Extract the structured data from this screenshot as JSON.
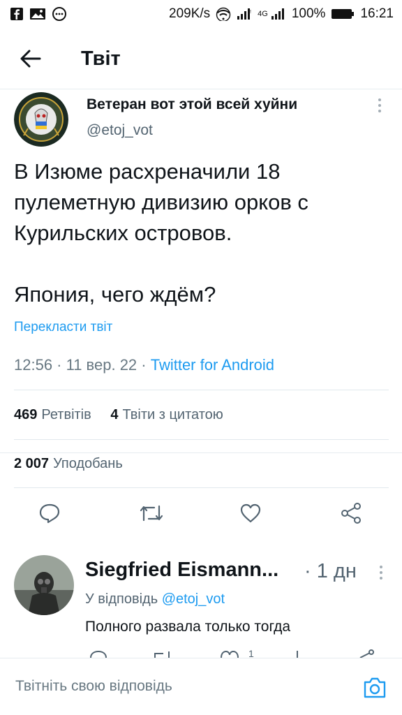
{
  "status_bar": {
    "network_speed": "209K/s",
    "signal_small": "4G",
    "battery": "100%",
    "time": "16:21",
    "left_icons": [
      "facebook-icon",
      "image-icon",
      "message-icon"
    ],
    "right_icons": [
      "wifi-icon",
      "signal-icon",
      "signal-4g-icon",
      "battery-icon"
    ]
  },
  "header": {
    "title": "Твіт",
    "back_icon": "arrow-left-icon"
  },
  "tweet": {
    "author_name": "Ветеран вот этой всей хуйни",
    "author_handle": "@etoj_vot",
    "text_lines": [
      "В Изюме расхреначили 18 пулеметную дивизию орков с Курильских островов.",
      "Япония, чего ждём?"
    ],
    "translate_label": "Перекласти твіт",
    "time": "12:56 · 11 вер. 22 · ",
    "source": "Twitter for Android",
    "retweets_count": "469",
    "retweets_label": "Ретвітів",
    "quotes_count": "4",
    "quotes_label": "Твіти з цитатою",
    "likes_count": "2 007",
    "likes_label": "Уподобань",
    "actions": [
      "reply-icon",
      "retweet-icon",
      "like-icon",
      "share-icon"
    ]
  },
  "reply": {
    "author_name": "Siegfried Eismann...",
    "time": "· 1 дн",
    "reply_to_label": "У відповідь",
    "reply_to_handle": "@etoj_vot",
    "text": "Полного развала только тогда",
    "like_count": "1"
  },
  "compose": {
    "placeholder": "Твітніть свою відповідь",
    "camera_icon": "camera-icon"
  },
  "colors": {
    "accent": "#1d9bf0",
    "text_primary": "#0f1419",
    "text_secondary": "#536471",
    "divider": "#e1e8ed"
  }
}
